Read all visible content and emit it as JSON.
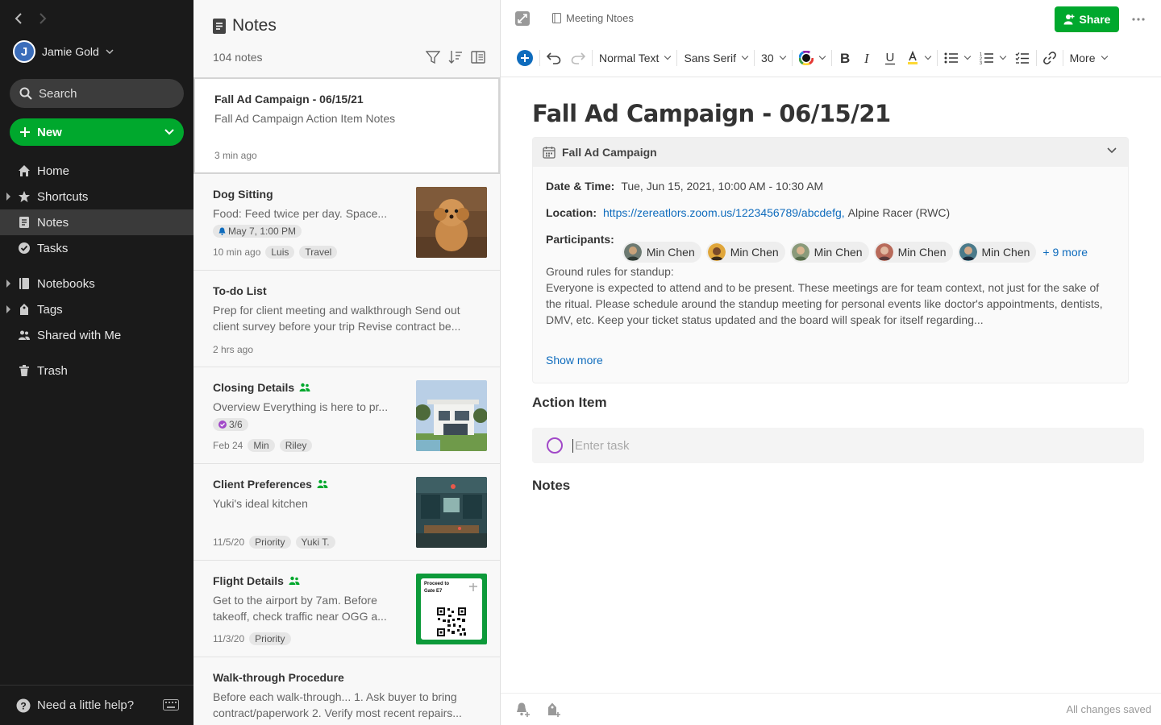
{
  "sidebar": {
    "user_name": "Jamie Gold",
    "avatar_letter": "J",
    "search_placeholder": "Search",
    "new_label": "New",
    "items": [
      {
        "label": "Home"
      },
      {
        "label": "Shortcuts"
      },
      {
        "label": "Notes"
      },
      {
        "label": "Tasks"
      },
      {
        "label": "Notebooks"
      },
      {
        "label": "Tags"
      },
      {
        "label": "Shared with Me"
      },
      {
        "label": "Trash"
      }
    ],
    "help_label": "Need a little help?"
  },
  "notelist": {
    "title": "Notes",
    "count": "104 notes",
    "cards": [
      {
        "title": "Fall Ad Campaign - 06/15/21",
        "snippet": "Fall Ad Campaign Action Item Notes",
        "time": "3 min ago"
      },
      {
        "title": "Dog Sitting",
        "snippet": "Food: Feed twice per day. Space...",
        "reminder": "May 7, 1:00 PM",
        "time": "10 min ago",
        "tags": [
          "Luis",
          "Travel"
        ]
      },
      {
        "title": "To-do List",
        "snippet": "Prep for client meeting and walkthrough Send out client survey before your trip Revise contract be...",
        "time": "2 hrs ago"
      },
      {
        "title": "Closing Details",
        "snippet": "Overview Everything is here to pr...",
        "progress": "3/6",
        "time": "Feb 24",
        "tags": [
          "Min",
          "Riley"
        ]
      },
      {
        "title": "Client Preferences",
        "snippet": "Yuki's ideal kitchen",
        "time": "11/5/20",
        "tags": [
          "Priority",
          "Yuki T."
        ]
      },
      {
        "title": "Flight Details",
        "snippet": "Get to the airport by 7am. Before takeoff, check traffic near OGG a...",
        "time": "11/3/20",
        "tags": [
          "Priority"
        ],
        "boarding_text": "Proceed to Gate E7"
      },
      {
        "title": "Walk-through Procedure",
        "snippet": "Before each walk-through... 1. Ask buyer to bring contract/paperwork 2. Verify most recent repairs..."
      }
    ]
  },
  "editor": {
    "breadcrumb": "Meeting Ntoes",
    "share_label": "Share",
    "toolbar": {
      "style": "Normal Text",
      "font": "Sans Serif",
      "size": "30",
      "more": "More"
    },
    "title": "Fall Ad Campaign - 06/15/21",
    "meeting": {
      "header": "Fall Ad Campaign",
      "date_label": "Date & Time:",
      "date_value": "Tue, Jun 15, 2021, 10:00 AM - 10:30 AM",
      "location_label": "Location:",
      "location_link": "https://zereatlors.zoom.us/1223456789/abcdefg,",
      "location_extra": "Alpine Racer (RWC)",
      "participants_label": "Participants:",
      "participants": [
        "Min Chen",
        "Min Chen",
        "Min Chen",
        "Min Chen",
        "Min Chen"
      ],
      "more_participants": "+ 9 more",
      "rules_title": "Ground rules for standup:",
      "rules_body": "Everyone is expected to attend and to be present. These meetings are for team context, not just for the sake of the ritual. Please schedule around the standup meeting for personal events like doctor's appointments, dentists, DMV, etc. Keep your ticket status updated and the board will speak for itself regarding...",
      "show_more": "Show more"
    },
    "action_item_heading": "Action Item",
    "task_placeholder": "Enter task",
    "notes_heading": "Notes",
    "status": "All changes saved"
  },
  "colors": {
    "accent_green": "#00a82d",
    "sidebar_bg": "#1a1a1a",
    "link_blue": "#0f6cbd",
    "task_purple": "#a148c8"
  }
}
